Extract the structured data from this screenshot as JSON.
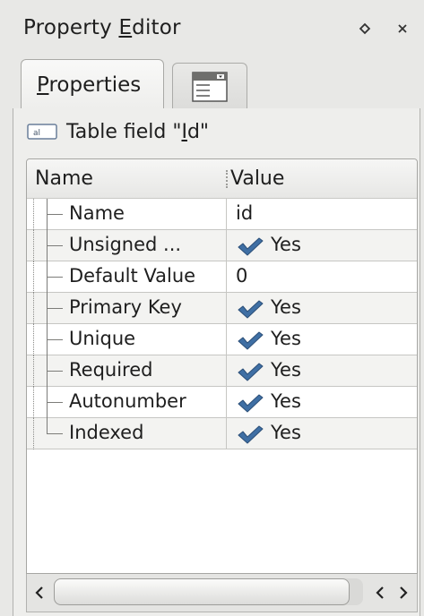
{
  "window": {
    "title_pre": "Property ",
    "title_mnemonic": "E",
    "title_post": "ditor",
    "float_icon": "float-icon",
    "close_icon": "close-icon"
  },
  "tabs": [
    {
      "label_mnemonic": "P",
      "label_rest": "roperties",
      "active": true
    },
    {
      "icon": "data-table-icon",
      "active": false
    }
  ],
  "object": {
    "icon": "text-field-icon",
    "label_pre": "Table field \"",
    "label_mnemonic": "I",
    "label_post": "d\""
  },
  "grid": {
    "columns": {
      "name": "Name",
      "value": "Value"
    },
    "rows": [
      {
        "name": "Name",
        "value": "id",
        "checked": false
      },
      {
        "name": "Unsigned ...",
        "value": "Yes",
        "checked": true
      },
      {
        "name": "Default Value",
        "value": "0",
        "checked": false
      },
      {
        "name": "Primary Key",
        "value": "Yes",
        "checked": true
      },
      {
        "name": "Unique",
        "value": "Yes",
        "checked": true
      },
      {
        "name": "Required",
        "value": "Yes",
        "checked": true
      },
      {
        "name": "Autonumber",
        "value": "Yes",
        "checked": true
      },
      {
        "name": "Indexed",
        "value": "Yes",
        "checked": true
      }
    ]
  },
  "scrollbar": {
    "left_arrow": "<",
    "right_arrow": ">"
  },
  "colors": {
    "check": "#3f6fa4",
    "window_bg": "#e8e8e6",
    "grid_bg": "#ffffff"
  }
}
